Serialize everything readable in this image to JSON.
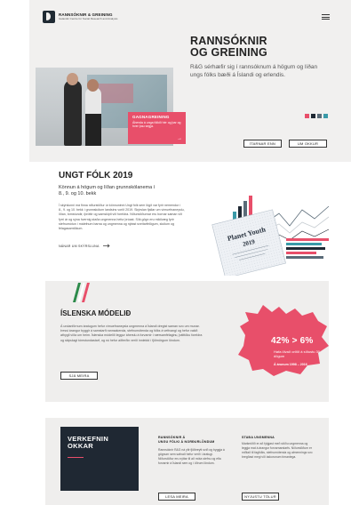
{
  "header": {
    "logo_name": "RANNSÓKNIR & GREINING",
    "logo_sub": "Icelandic Centre for Social Research and Analysis",
    "menu_icon": "hamburger-menu-icon"
  },
  "hero": {
    "title": "RANNSÓKNIR\nOG GREINING",
    "text": "R&G sérhæfir sig í rannsóknum á högum og líðan ungs fólks bæði á Íslandi og erlendis.",
    "highlight": {
      "title": "GAGNAGREINING",
      "text": "Áhersla á unga fólkið hér og þar og hver þau segja.",
      "arrow": "→"
    },
    "swatches": [
      "#e84f6a",
      "#1f2833",
      "#5a6b78",
      "#3a9aa8"
    ],
    "buttons": {
      "primary": "ÍTARNAR ENN",
      "secondary": "UM OKKUR"
    }
  },
  "youth": {
    "title": "UNGT FÓLK 2019",
    "subtitle": "Könnun á högum og líðan grunnskólanema í 8., 9. og 10. bekk",
    "body": "Í skýrslunni má finna niðurstöður úr könnuninni Ungt fólk sem lögð var fyrir nemendur í 8., 9. og 10. bekk í grunnskólum landsins vorið 2019. Skýrslan fjallar um vímuefnaneyslu, líðan, tómstundir, íþróttir og samskipti við foreldra. Niðurstöðurnar eru bornar saman við fyrri ár og sýna hvernig staða ungmenna hefur þróast. Slík gögn eru mikilvæg fyrir stefnumótun í málefnum barna og ungmenna og nýtast sveitarfélögum, skólum og félagasamtökum.",
    "link": "NÁNAR UM SKÝRSLUNA",
    "link_icon": "arrow-right-icon",
    "report": {
      "title": "Planet Youth",
      "year": "2019"
    }
  },
  "model": {
    "title": "ÍSLENSKA MÓDELIÐ",
    "body": "Á undanförnum áratugum hefur vímuefnaneysla ungmenna á Íslandi dregist saman svo um munar. Þessi árangur byggir á samstarfi rannsakenda, stefnumótenda og fólks á vettvangi og hefur vakið athygli víða um heim. Íslenska módelið leggur áherslu á forvarnir í nærsamfélaginu, þátttöku foreldra og skipulagt tómstundastarf, og nú hefur aðferðin verið innleidd í fjölmörgum löndum.",
    "button": "SJÁ MEIRA",
    "stat_big": "42% > 6%",
    "stat_sub": "Hafa ölvað orðið á síðustu 30 dögum",
    "stat_years": "Á árunum 1998 – 2016"
  },
  "projects": {
    "title": "VERKEFNIN\nOKKAR",
    "col1_title": "RANNSÓKNIR Á\nUNGU FÓLKI Á NORÐURLÖNDUM",
    "col1_body": "Rannsóknir R&G ná yfir fjölbreytt svið og byggja á gögnum sem safnað hefur verið í áratugi. Niðurstöður eru nýttar til að móta stefnu og efla forvarnir á Íslandi sem og í öðrum löndum.",
    "col1_button": "LESA MEIRA",
    "col2_title": "STAÐA UNGMENNA",
    "col2_body": "Markmiðið er að fylgjast með stöðu ungmenna og leggja mat á árangur forvarnarstarfs. Niðurstöðum er miðlað til fagfólks, stefnumótenda og almennings svo bregðast megi við áskorunum tímanlega.",
    "col2_button": "NÝJUSTU TÖLUR"
  }
}
